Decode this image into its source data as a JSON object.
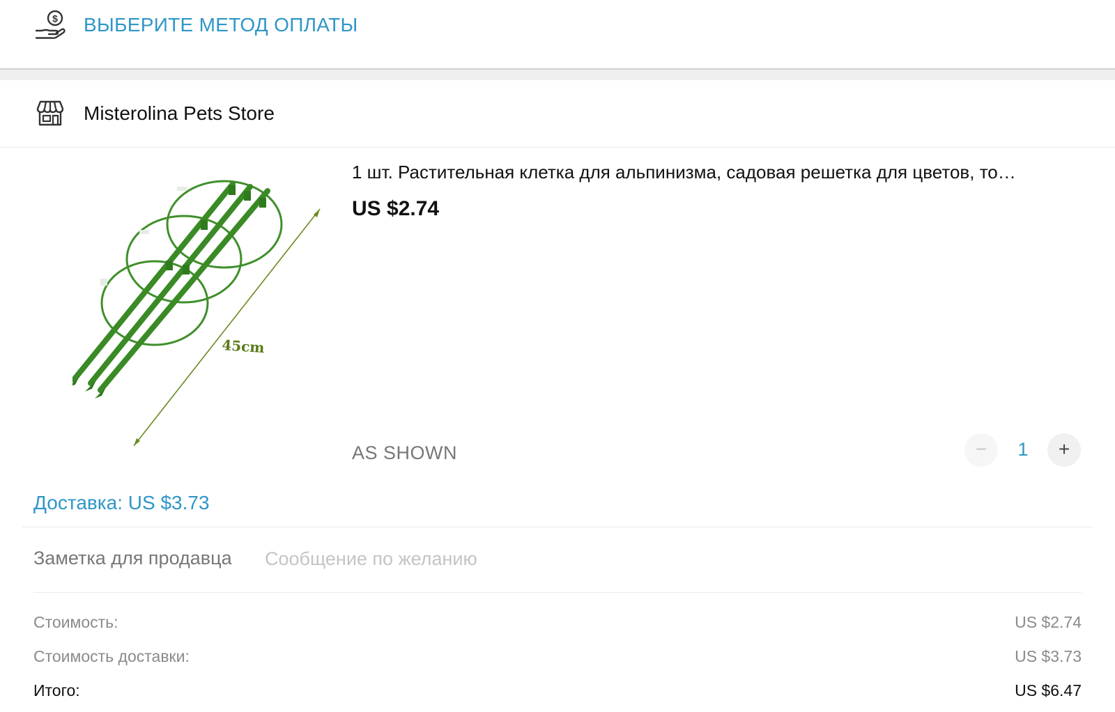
{
  "payment": {
    "label": "ВЫБЕРИТЕ МЕТОД ОПЛАТЫ",
    "icon": "hand-dollar-icon"
  },
  "store": {
    "name": "Misterolina Pets Store",
    "icon": "storefront-icon"
  },
  "product": {
    "title": "1 шт. Растительная клетка для альпинизма, садовая решетка для цветов, то…",
    "price": "US $2.74",
    "variant": "AS  SHOWN",
    "image_label": "45cm",
    "quantity": "1",
    "minus_label": "−",
    "plus_label": "+"
  },
  "shipping": {
    "label": "Доставка: US $3.73"
  },
  "seller_note": {
    "label": "Заметка для продавца",
    "placeholder": "Сообщение по желанию",
    "value": ""
  },
  "summary": {
    "rows": [
      {
        "label": "Стоимость:",
        "value": "US $2.74"
      },
      {
        "label": "Стоимость доставки:",
        "value": "US $3.73"
      },
      {
        "label": "Итого:",
        "value": "US $6.47"
      }
    ]
  },
  "colors": {
    "accent": "#2f96c7",
    "plant_green": "#3f8f2a",
    "muted_text": "#8a8a8a",
    "divider": "#ececec"
  }
}
